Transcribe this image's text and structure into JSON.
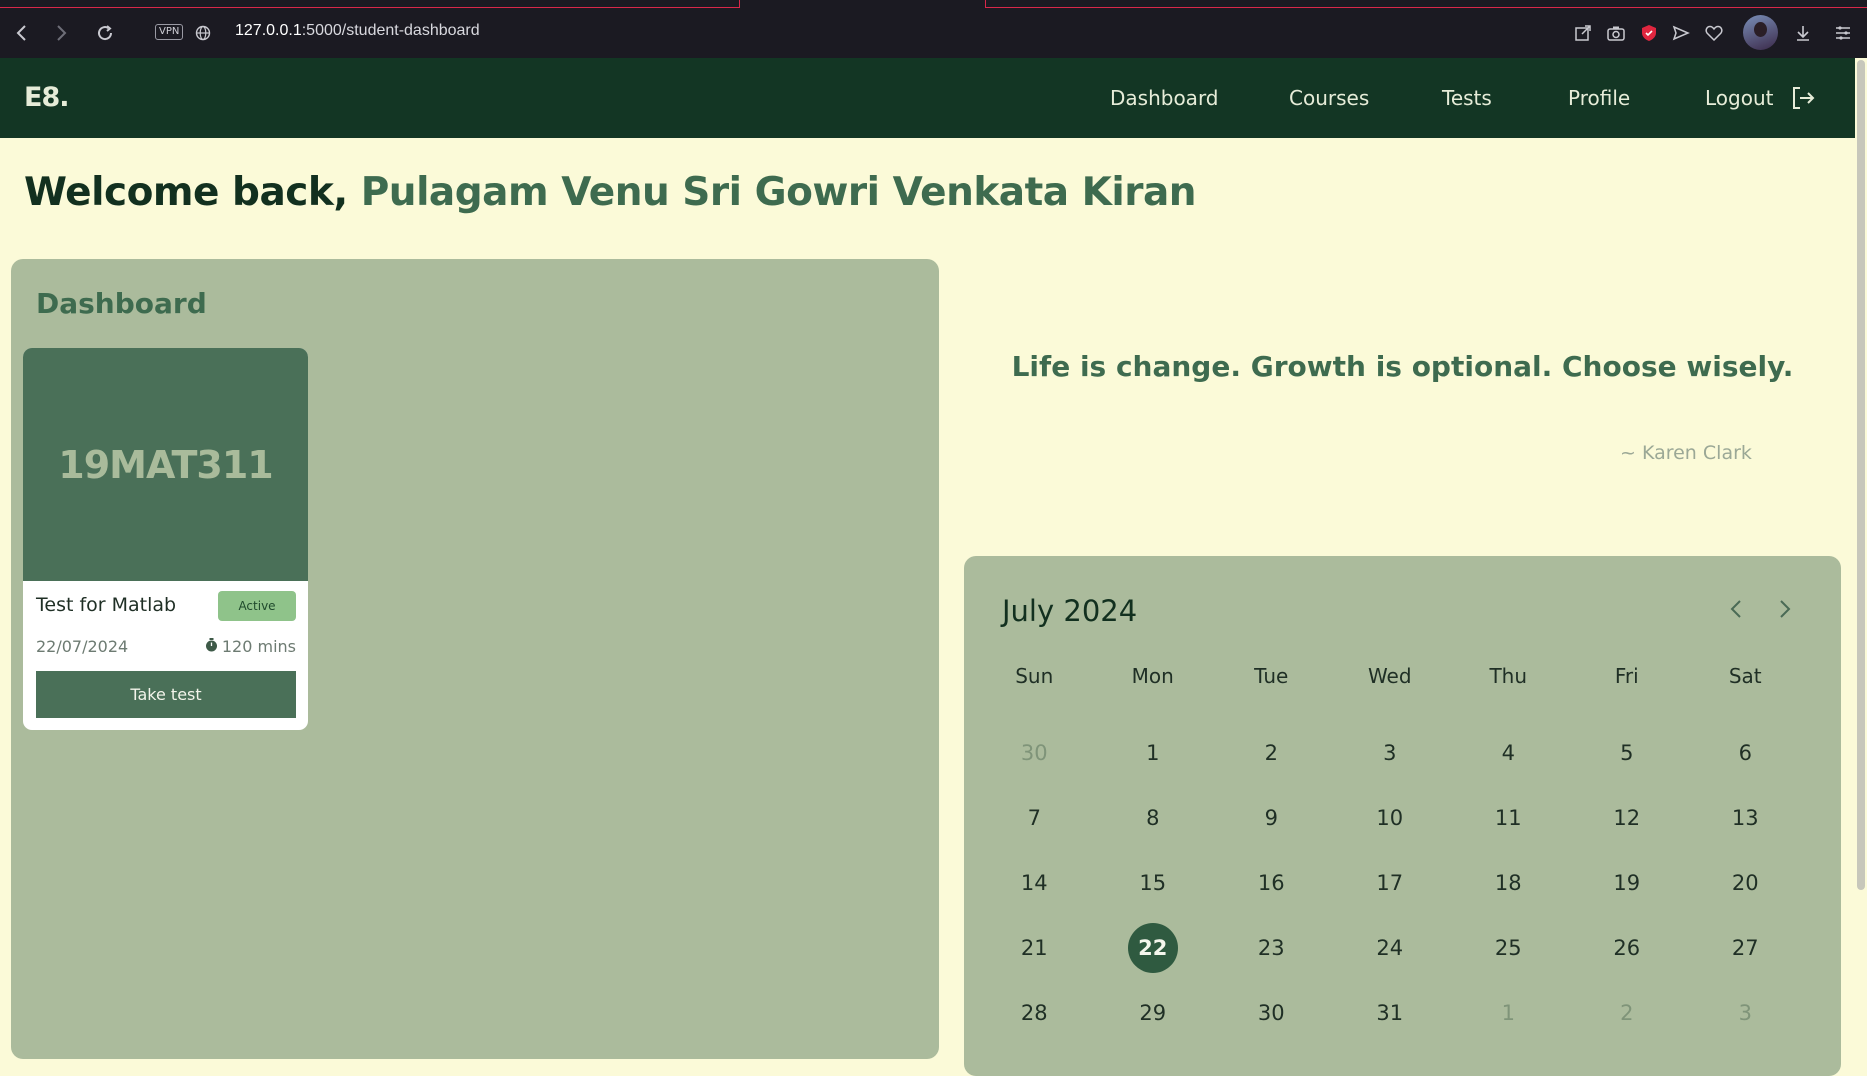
{
  "browser": {
    "url_host": "127.0.0.1",
    "url_path": ":5000/student-dashboard",
    "vpn_label": "VPN"
  },
  "navbar": {
    "logo": "E8.",
    "items": [
      {
        "label": "Dashboard"
      },
      {
        "label": "Courses"
      },
      {
        "label": "Tests"
      },
      {
        "label": "Profile"
      },
      {
        "label": "Logout"
      }
    ]
  },
  "welcome": {
    "prefix": "Welcome back, ",
    "name": "Pulagam Venu Sri Gowri Venkata Kiran"
  },
  "dashboard": {
    "title": "Dashboard",
    "test_card": {
      "code": "19MAT311",
      "name": "Test for Matlab",
      "status": "Active",
      "date": "22/07/2024",
      "duration": "120 mins",
      "button_label": "Take test"
    }
  },
  "quote": {
    "text": "Life is change. Growth is optional. Choose wisely.",
    "author": "~ Karen Clark"
  },
  "calendar": {
    "title": "July 2024",
    "weekdays": [
      "Sun",
      "Mon",
      "Tue",
      "Wed",
      "Thu",
      "Fri",
      "Sat"
    ],
    "weeks": [
      [
        "30",
        "1",
        "2",
        "3",
        "4",
        "5",
        "6"
      ],
      [
        "7",
        "8",
        "9",
        "10",
        "11",
        "12",
        "13"
      ],
      [
        "14",
        "15",
        "16",
        "17",
        "18",
        "19",
        "20"
      ],
      [
        "21",
        "22",
        "23",
        "24",
        "25",
        "26",
        "27"
      ],
      [
        "28",
        "29",
        "30",
        "31",
        "1",
        "2",
        "3"
      ]
    ],
    "selected": "22",
    "colors": {
      "selected_bg": "#2f5a40",
      "panel_bg": "#abbb9c"
    }
  },
  "colors": {
    "page_bg": "#fbfad8",
    "navbar_bg": "#133624",
    "accent": "#3e6b4f"
  }
}
